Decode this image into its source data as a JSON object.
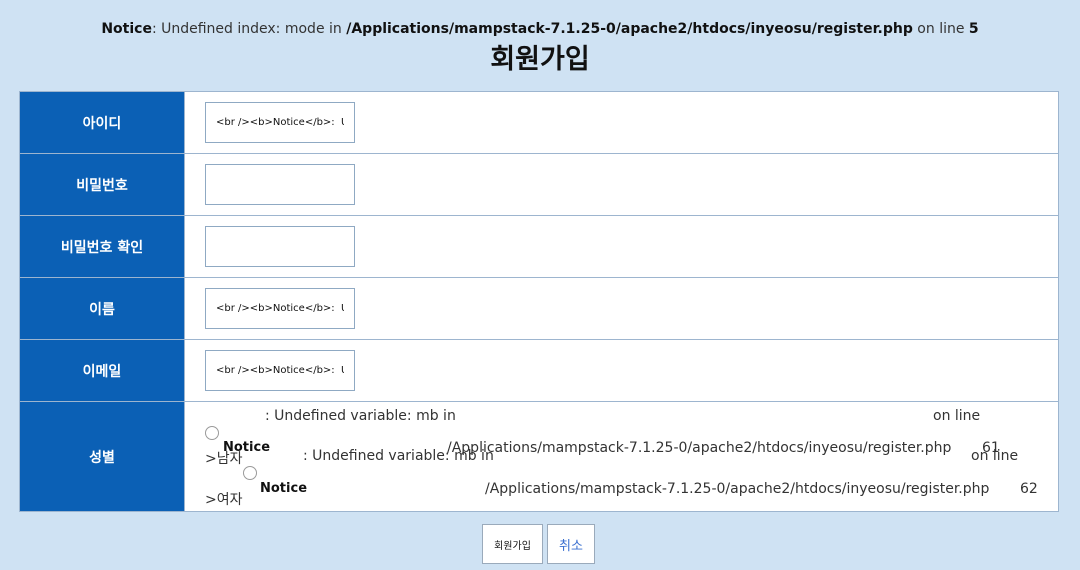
{
  "notice": {
    "label": "Notice",
    "text1": ": Undefined index: mode in ",
    "path": "/Applications/mampstack-7.1.25-0/apache2/htdocs/inyeosu/register.php",
    "text2": " on line ",
    "line": "5"
  },
  "page_title": "회원가입",
  "form": {
    "rows": [
      {
        "label": "아이디",
        "value": "<br /><b>Notice</b>:  U"
      },
      {
        "label": "비밀번호",
        "value": ""
      },
      {
        "label": "비밀번호 확인",
        "value": ""
      },
      {
        "label": "이름",
        "value": "<br /><b>Notice</b>:  U"
      },
      {
        "label": "이메일",
        "value": "<br /><b>Notice</b>:  U"
      }
    ],
    "gender": {
      "label": "성별",
      "male": {
        "undefined_text": ": Undefined variable: mb in",
        "on_line": "on line",
        "notice": "Notice",
        "path": "/Applications/mampstack-7.1.25-0/apache2/htdocs/inyeosu/register.php",
        "line": "61",
        "label": ">남자"
      },
      "female": {
        "undefined_text": ": Undefined variable: mb in",
        "on_line": "on line",
        "notice": "Notice",
        "path": "/Applications/mampstack-7.1.25-0/apache2/htdocs/inyeosu/register.php",
        "line": "62",
        "label": ">여자"
      }
    }
  },
  "buttons": {
    "submit": "회원가입",
    "cancel": "취소"
  }
}
